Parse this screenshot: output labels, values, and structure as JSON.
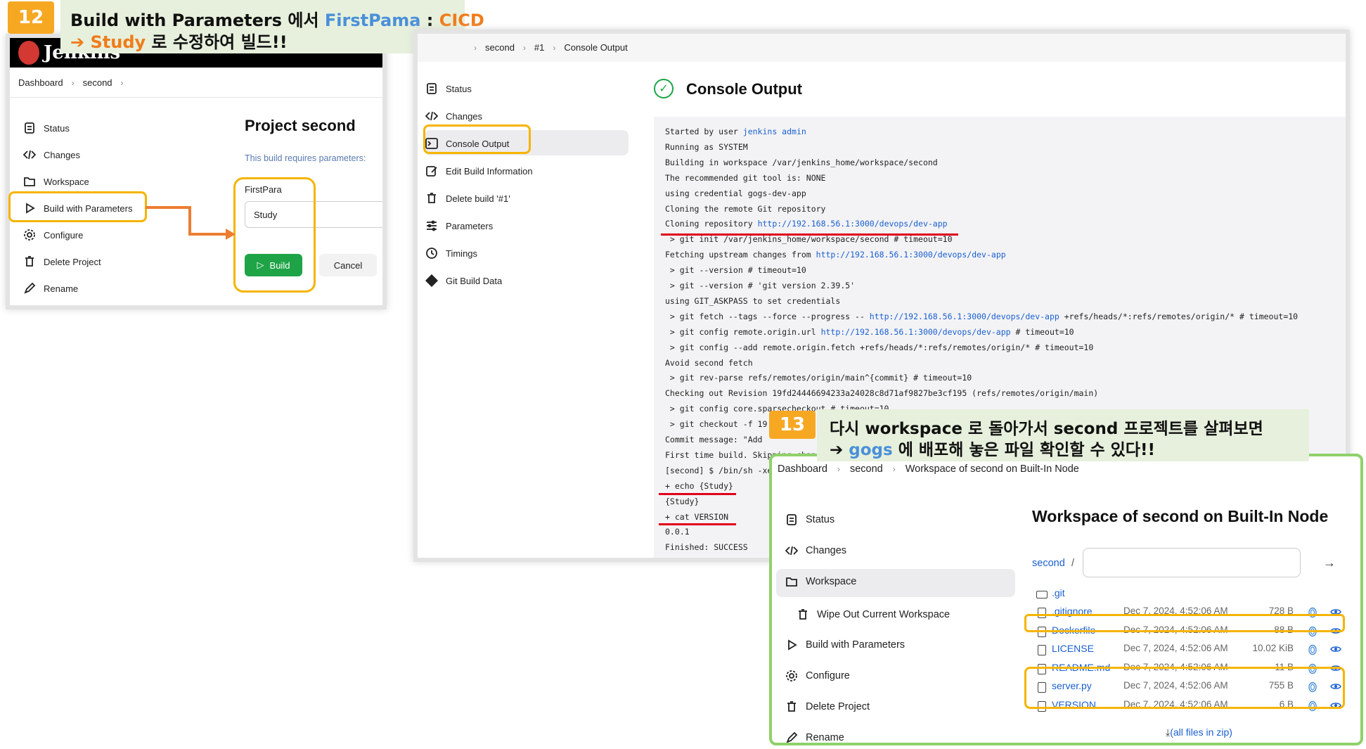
{
  "callout12": {
    "badge": "12",
    "line1_a": "Build with Parameters 에서 ",
    "line1_b": "FirstPama",
    "line1_c": " : ",
    "line1_d": "CICD",
    "line2_arrow": "➔ ",
    "line2_b": "Study",
    "line2_c": " 로 수정하여 빌드!!"
  },
  "callout13": {
    "badge": "13",
    "line1": "다시 workspace 로 돌아가서 second 프로젝트를 살펴보면",
    "line2_arrow": "➔ ",
    "line2_b": "gogs",
    "line2_c": " 에 배포해 놓은 파일 확인할 수 있다!!"
  },
  "panel1": {
    "logo_text": "Jenkins",
    "breadcrumb": [
      "Dashboard",
      "second"
    ],
    "sidebar": [
      "Status",
      "Changes",
      "Workspace",
      "Build with Parameters",
      "Configure",
      "Delete Project",
      "Rename"
    ],
    "title": "Project second",
    "subtitle": "This build requires parameters:",
    "param_label": "FirstPara",
    "param_value": "Study",
    "build_button": "Build",
    "cancel_button": "Cancel"
  },
  "panel2": {
    "breadcrumb": [
      "second",
      "#1",
      "Console Output"
    ],
    "sidebar": [
      "Status",
      "Changes",
      "Console Output",
      "Edit Build Information",
      "Delete build '#1'",
      "Parameters",
      "Timings",
      "Git Build Data"
    ],
    "title": "Console Output",
    "console": [
      {
        "t": "Started by user ",
        "l": "jenkins admin"
      },
      {
        "t": "Running as SYSTEM"
      },
      {
        "t": "Building in workspace /var/jenkins_home/workspace/second"
      },
      {
        "t": "The recommended git tool is: NONE"
      },
      {
        "t": "using credential gogs-dev-app"
      },
      {
        "t": "Cloning the remote Git repository"
      },
      {
        "t": "Cloning repository ",
        "l": "http://192.168.56.1:3000/devops/dev-app"
      },
      {
        "t": " > git init /var/jenkins_home/workspace/second # timeout=10"
      },
      {
        "t": "Fetching upstream changes from ",
        "l": "http://192.168.56.1:3000/devops/dev-app"
      },
      {
        "t": " > git --version # timeout=10"
      },
      {
        "t": " > git --version # 'git version 2.39.5'"
      },
      {
        "t": "using GIT_ASKPASS to set credentials"
      },
      {
        "t": " > git fetch --tags --force --progress -- ",
        "l": "http://192.168.56.1:3000/devops/dev-app",
        "t2": " +refs/heads/*:refs/remotes/origin/* # timeout=10"
      },
      {
        "t": " > git config remote.origin.url ",
        "l": "http://192.168.56.1:3000/devops/dev-app",
        "t2": " # timeout=10"
      },
      {
        "t": " > git config --add remote.origin.fetch +refs/heads/*:refs/remotes/origin/* # timeout=10"
      },
      {
        "t": "Avoid second fetch"
      },
      {
        "t": " > git rev-parse refs/remotes/origin/main^{commit} # timeout=10"
      },
      {
        "t": "Checking out Revision 19fd24446694233a24028c8d71af9827be3cf195 (refs/remotes/origin/main)"
      },
      {
        "t": " > git config core.sparsecheckout # timeout=10"
      },
      {
        "t": " > git checkout -f 19"
      },
      {
        "t": "Commit message: \"Add "
      },
      {
        "t": "First time build. Skipping chang"
      },
      {
        "t": "[second] $ /bin/sh -xe"
      },
      {
        "t": "+ echo {Study}"
      },
      {
        "t": "{Study}"
      },
      {
        "t": "+ cat VERSION"
      },
      {
        "t": "0.0.1"
      },
      {
        "t": "Finished: SUCCESS"
      }
    ]
  },
  "panel3": {
    "breadcrumb": [
      "Dashboard",
      "second",
      "Workspace of second on Built-In Node"
    ],
    "sidebar": [
      "Status",
      "Changes",
      "Workspace",
      "Wipe Out Current Workspace",
      "Build with Parameters",
      "Configure",
      "Delete Project",
      "Rename"
    ],
    "title": "Workspace of second on Built-In Node",
    "path_link": "second",
    "path_sep": "/",
    "folder": ".git",
    "files": [
      {
        "name": ".gitignore",
        "date": "Dec 7, 2024, 4:52:06 AM",
        "size": "728 B"
      },
      {
        "name": "Dockerfile",
        "date": "Dec 7, 2024, 4:52:06 AM",
        "size": "88 B"
      },
      {
        "name": "LICENSE",
        "date": "Dec 7, 2024, 4:52:06 AM",
        "size": "10.02 KiB"
      },
      {
        "name": "README.md",
        "date": "Dec 7, 2024, 4:52:06 AM",
        "size": "11 B"
      },
      {
        "name": "server.py",
        "date": "Dec 7, 2024, 4:52:06 AM",
        "size": "755 B"
      },
      {
        "name": "VERSION",
        "date": "Dec 7, 2024, 4:52:06 AM",
        "size": "6 B"
      }
    ],
    "zip_link": "(all files in zip)"
  },
  "colors": {
    "accent_orange": "#f5b400",
    "arrow_orange": "#ed7d31",
    "green_frame": "#8fd16a",
    "build_green": "#1ea446",
    "link_blue": "#1a5fd0"
  }
}
